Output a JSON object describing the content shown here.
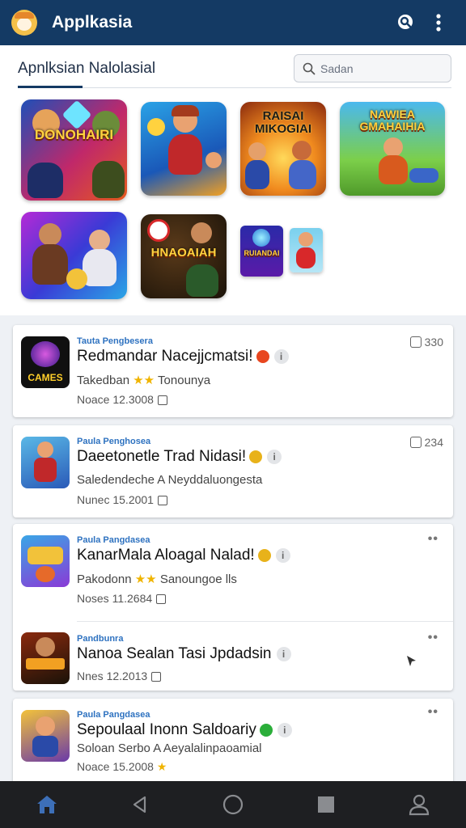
{
  "appbar": {
    "title": "Applkasia",
    "icons": [
      "app-logo-icon",
      "help-search-icon",
      "more-vert-icon"
    ],
    "color": "#143a64"
  },
  "featured": {
    "title": "Apnlksian Nalolasial",
    "search_placeholder": "Sadan",
    "tiles": [
      {
        "caption": "DONOHAIRI",
        "icon": "game-tile-icon"
      },
      {
        "caption": "",
        "icon": "game-tile-icon"
      },
      {
        "caption": "RAISAI MIKOGIAI",
        "icon": "game-tile-icon"
      },
      {
        "caption": "NAWIEA GMAHAIHIA",
        "icon": "game-tile-icon"
      },
      {
        "caption": "",
        "icon": "game-tile-icon"
      },
      {
        "caption": "HNAOAIAH",
        "icon": "game-tile-icon"
      },
      {
        "caption": "RUIANDAI",
        "icon": "game-tile-icon"
      },
      {
        "caption": "",
        "icon": "game-tile-icon"
      }
    ]
  },
  "list": {
    "rows": [
      {
        "category": "Tauta Pengbesera",
        "title": "Redmandar Nacejjcmatsi!",
        "subtitle_prefix": "Takedban",
        "stars": "★★",
        "subtitle_suffix": "Tonounya",
        "date": "Noace 12.3008",
        "count": "330",
        "badge_color": "#e8461f"
      },
      {
        "category": "Paula Penghosea",
        "title": "Daeetonetle Trad Nidasi!",
        "subtitle_prefix": "Saledendeche A Neyddaluongesta",
        "stars": "",
        "subtitle_suffix": "",
        "date": "Nunec 15.2001",
        "count": "234",
        "badge_color": "#e8b21a"
      },
      {
        "category": "Paula Pangdasea",
        "title": "KanarMala Aloagal Nalad!",
        "subtitle_prefix": "Pakodonn",
        "stars": "★★",
        "subtitle_suffix": "Sanoungoe lls",
        "date": "Noses 11.2684",
        "count": "",
        "badge_color": "#e8b21a"
      },
      {
        "category": "Pandbunra",
        "title": "Nanoa Sealan Tasi Jpdadsin",
        "subtitle_prefix": "",
        "stars": "",
        "subtitle_suffix": "",
        "date": "Nnes 12.2013",
        "count": "",
        "badge_color": ""
      },
      {
        "category": "Paula Pangdasea",
        "title": "Sepoulaal Inonn Saldoariy",
        "subtitle_prefix": "Soloan Serbo A Aeyalalinpaoamial",
        "stars": "",
        "subtitle_suffix": "",
        "date": "Noace 15.2008",
        "count": "",
        "badge_color": "#2bae3a"
      }
    ]
  },
  "navbar": {
    "items": [
      "home-icon",
      "back-icon",
      "circle-home-icon",
      "recents-icon",
      "profile-icon"
    ]
  }
}
